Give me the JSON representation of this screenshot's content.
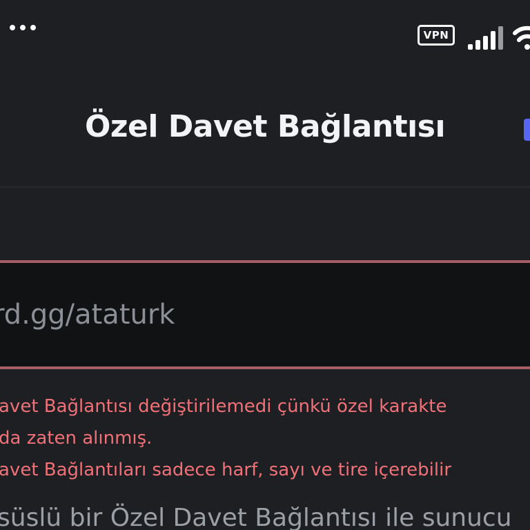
{
  "status_bar": {
    "vpn_label": "VPN",
    "icons": [
      "more-dots-icon",
      "vpn-icon",
      "signal-icon",
      "wifi-icon"
    ]
  },
  "header": {
    "title": "Özel Davet Bağlantısı"
  },
  "invite_input": {
    "value": "rd.gg/ataturk"
  },
  "errors": {
    "line1": "avet Bağlantısı değiştirilemedi çünkü özel karakte",
    "line2": " da zaten alınmış.",
    "line3": "avet Bağlantıları sadece harf, sayı ve tire içerebilir"
  },
  "helper": {
    "text": "süslü bir Özel Davet Bağlantısı ile sunucu"
  },
  "colors": {
    "background": "#1e1f22",
    "input_background": "#111214",
    "error": "#f07178",
    "error_border": "#a85f66",
    "accent": "#5865f2"
  }
}
